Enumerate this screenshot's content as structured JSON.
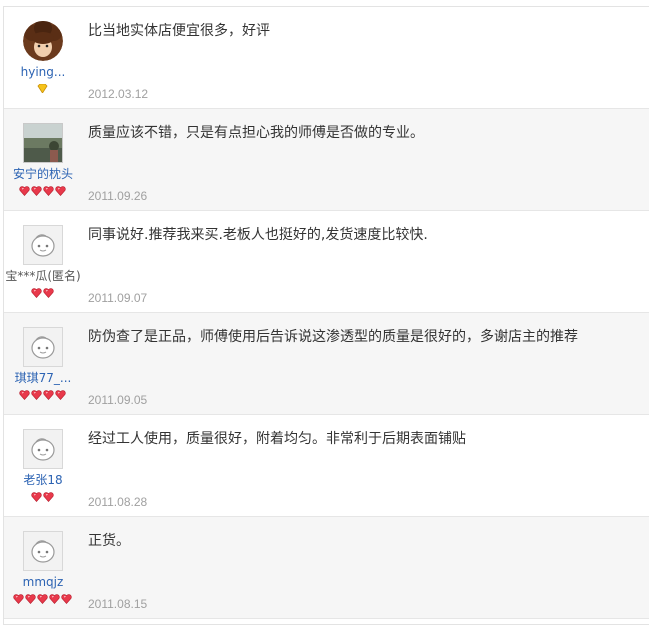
{
  "reviews": [
    {
      "user": "hying...",
      "avatar": "photo-brown-hair",
      "rank": "diamond-1",
      "text": "比当地实体店便宜很多，好评",
      "date": "2012.03.12"
    },
    {
      "user": "安宁的枕头",
      "avatar": "photo-landscape",
      "rank": "hearts-4",
      "text": "质量应该不错，只是有点担心我的师傅是否做的专业。",
      "date": "2011.09.26"
    },
    {
      "user": "宝***瓜(匿名)",
      "avatar": "default-face",
      "rank": "hearts-2",
      "text": "同事说好.推荐我来买.老板人也挺好的,发货速度比较快.",
      "date": "2011.09.07"
    },
    {
      "user": "琪琪77_...",
      "avatar": "default-face",
      "rank": "hearts-4",
      "text": "防伪查了是正品，师傅使用后告诉说这渗透型的质量是很好的，多谢店主的推荐",
      "date": "2011.09.05"
    },
    {
      "user": "老张18",
      "avatar": "default-face",
      "rank": "hearts-2",
      "text": "经过工人使用，质量很好，附着均匀。非常利于后期表面铺贴",
      "date": "2011.08.28"
    },
    {
      "user": "mmqjz",
      "avatar": "default-face",
      "rank": "hearts-5",
      "text": "正货。",
      "date": "2011.08.15"
    }
  ]
}
